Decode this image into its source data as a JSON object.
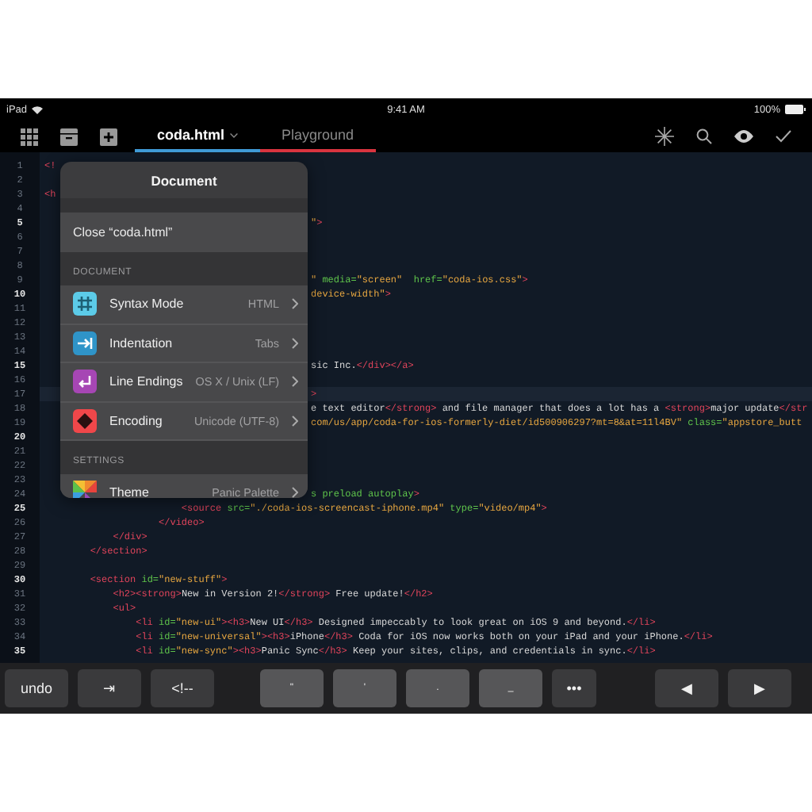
{
  "status_bar": {
    "device": "iPad",
    "time": "9:41 AM",
    "battery": "100%"
  },
  "toolbar": {
    "tabs": [
      {
        "label": "coda.html",
        "selected": true,
        "color": "#3f9ad6"
      },
      {
        "label": "Playground",
        "selected": false,
        "color": "#d9343f"
      }
    ]
  },
  "lines": [
    {
      "number": "1",
      "current": false,
      "left": [
        {
          "text": "<!",
          "kind": "tag"
        }
      ]
    },
    {
      "number": "2",
      "current": false
    },
    {
      "number": "3",
      "current": false,
      "left": [
        {
          "text": "<h",
          "kind": "tag"
        }
      ]
    },
    {
      "number": "4",
      "current": false
    },
    {
      "number": "5",
      "current": false,
      "tail": [
        {
          "text": "\"",
          "kind": "string"
        },
        {
          "text": ">",
          "kind": "tag"
        }
      ]
    },
    {
      "number": "6",
      "current": false
    },
    {
      "number": "7",
      "current": false
    },
    {
      "number": "8",
      "current": false
    },
    {
      "number": "9",
      "current": false,
      "tail": [
        {
          "text": "\"",
          "kind": "string"
        },
        {
          "text": " media=",
          "kind": "attr"
        },
        {
          "text": "\"screen\"",
          "kind": "string"
        },
        {
          "text": "  href=",
          "kind": "attr"
        },
        {
          "text": "\"coda-ios.css\"",
          "kind": "string"
        },
        {
          "text": ">",
          "kind": "tag"
        }
      ]
    },
    {
      "number": "10",
      "current": false,
      "tail": [
        {
          "text": "device-width\"",
          "kind": "string"
        },
        {
          "text": ">",
          "kind": "tag"
        }
      ]
    },
    {
      "number": "11",
      "current": false
    },
    {
      "number": "12",
      "current": false
    },
    {
      "number": "13",
      "current": false
    },
    {
      "number": "14",
      "current": false
    },
    {
      "number": "15",
      "current": false,
      "tail": [
        {
          "text": "sic Inc.",
          "kind": "text"
        },
        {
          "text": "</div></a>",
          "kind": "tag"
        }
      ]
    },
    {
      "number": "16",
      "current": false
    },
    {
      "number": "17",
      "current": true,
      "tail": [
        {
          "text": ">",
          "kind": "tag"
        }
      ]
    },
    {
      "number": "18",
      "current": false,
      "tail": [
        {
          "text": "e text editor",
          "kind": "text"
        },
        {
          "text": "</strong>",
          "kind": "tag"
        },
        {
          "text": " and file manager that does a lot has a ",
          "kind": "text"
        },
        {
          "text": "<strong>",
          "kind": "tag"
        },
        {
          "text": "major update",
          "kind": "text"
        },
        {
          "text": "</str",
          "kind": "tag"
        }
      ]
    },
    {
      "number": "19",
      "current": false,
      "tail": [
        {
          "text": "com/us/app/coda-for-ios-formerly-diet/id500906297?mt=8&at=11l4BV\"",
          "kind": "string"
        },
        {
          "text": " class=",
          "kind": "attr"
        },
        {
          "text": "\"appstore_butt",
          "kind": "string"
        }
      ]
    },
    {
      "number": "20",
      "current": false
    },
    {
      "number": "21",
      "current": false
    },
    {
      "number": "22",
      "current": false
    },
    {
      "number": "23",
      "current": false
    },
    {
      "number": "24",
      "current": false,
      "tail": [
        {
          "text": "s preload autoplay",
          "kind": "attr"
        },
        {
          "text": ">",
          "kind": "tag"
        }
      ]
    },
    {
      "number": "25",
      "current": false,
      "left": [
        {
          "text": "\t\t\t\t\t\t<source",
          "kind": "tag"
        },
        {
          "text": " src=",
          "kind": "attr"
        },
        {
          "text": "\"./coda-ios-screencast-iphone.mp4\"",
          "kind": "string"
        },
        {
          "text": " type=",
          "kind": "attr"
        },
        {
          "text": "\"video/mp4\"",
          "kind": "string"
        },
        {
          "text": ">",
          "kind": "tag"
        }
      ]
    },
    {
      "number": "26",
      "current": false,
      "left": [
        {
          "text": "\t\t\t\t\t</video>",
          "kind": "tag"
        }
      ]
    },
    {
      "number": "27",
      "current": false,
      "left": [
        {
          "text": "\t\t\t</div>",
          "kind": "tag"
        }
      ]
    },
    {
      "number": "28",
      "current": false,
      "left": [
        {
          "text": "\t\t</section>",
          "kind": "tag"
        }
      ]
    },
    {
      "number": "29",
      "current": false
    },
    {
      "number": "30",
      "current": false,
      "left": [
        {
          "text": "\t\t<section",
          "kind": "tag"
        },
        {
          "text": " id=",
          "kind": "attr"
        },
        {
          "text": "\"new-stuff\"",
          "kind": "string"
        },
        {
          "text": ">",
          "kind": "tag"
        }
      ]
    },
    {
      "number": "31",
      "current": false,
      "left": [
        {
          "text": "\t\t\t<h2><strong>",
          "kind": "tag"
        },
        {
          "text": "New in Version 2!",
          "kind": "text"
        },
        {
          "text": "</strong>",
          "kind": "tag"
        },
        {
          "text": " Free update!",
          "kind": "text"
        },
        {
          "text": "</h2>",
          "kind": "tag"
        }
      ]
    },
    {
      "number": "32",
      "current": false,
      "left": [
        {
          "text": "\t\t\t<ul>",
          "kind": "tag"
        }
      ]
    },
    {
      "number": "33",
      "current": false,
      "left": [
        {
          "text": "\t\t\t\t<li",
          "kind": "tag"
        },
        {
          "text": " id=",
          "kind": "attr"
        },
        {
          "text": "\"new-ui\"",
          "kind": "string"
        },
        {
          "text": "><h3>",
          "kind": "tag"
        },
        {
          "text": "New UI",
          "kind": "text"
        },
        {
          "text": "</h3>",
          "kind": "tag"
        },
        {
          "text": " Designed impeccably to look great on iOS 9 and beyond.",
          "kind": "text"
        },
        {
          "text": "</li>",
          "kind": "tag"
        }
      ]
    },
    {
      "number": "34",
      "current": false,
      "left": [
        {
          "text": "\t\t\t\t<li",
          "kind": "tag"
        },
        {
          "text": " id=",
          "kind": "attr"
        },
        {
          "text": "\"new-universal\"",
          "kind": "string"
        },
        {
          "text": "><h3>",
          "kind": "tag"
        },
        {
          "text": "iPhone",
          "kind": "text"
        },
        {
          "text": "</h3>",
          "kind": "tag"
        },
        {
          "text": " Coda for iOS now works both on your iPad and your iPhone.",
          "kind": "text"
        },
        {
          "text": "</li>",
          "kind": "tag"
        }
      ]
    },
    {
      "number": "35",
      "current": false,
      "left": [
        {
          "text": "\t\t\t\t<li",
          "kind": "tag"
        },
        {
          "text": " id=",
          "kind": "attr"
        },
        {
          "text": "\"new-sync\"",
          "kind": "string"
        },
        {
          "text": "><h3>",
          "kind": "tag"
        },
        {
          "text": "Panic Sync",
          "kind": "text"
        },
        {
          "text": "</h3>",
          "kind": "tag"
        },
        {
          "text": " Keep your sites, clips, and credentials in sync.",
          "kind": "text"
        },
        {
          "text": "</li>",
          "kind": "tag"
        }
      ]
    }
  ],
  "popover": {
    "title": "Document",
    "close_label": "Close “coda.html”",
    "sections": [
      {
        "header": "DOCUMENT",
        "items": [
          {
            "kind": "syntax",
            "label": "Syntax Mode",
            "value": "HTML"
          },
          {
            "kind": "indent",
            "label": "Indentation",
            "value": "Tabs"
          },
          {
            "kind": "endings",
            "label": "Line Endings",
            "value": "OS X / Unix (LF)"
          },
          {
            "kind": "encoding",
            "label": "Encoding",
            "value": "Unicode (UTF-8)"
          }
        ]
      },
      {
        "header": "SETTINGS",
        "items": [
          {
            "kind": "theme",
            "label": "Theme",
            "value": "Panic Palette"
          }
        ]
      }
    ]
  },
  "keys": [
    {
      "label": "undo",
      "kind": "edit"
    },
    {
      "label": "⇥",
      "kind": "edit"
    },
    {
      "label": "<!--",
      "kind": "edit"
    },
    {
      "label": "\"",
      "kind": "punct"
    },
    {
      "label": "'",
      "kind": "punct"
    },
    {
      "label": ".",
      "kind": "punct"
    },
    {
      "label": "_",
      "kind": "punct"
    },
    {
      "label": "•••",
      "kind": "more"
    },
    {
      "label": "◀",
      "kind": "arrow"
    },
    {
      "label": "▶",
      "kind": "arrow"
    }
  ]
}
